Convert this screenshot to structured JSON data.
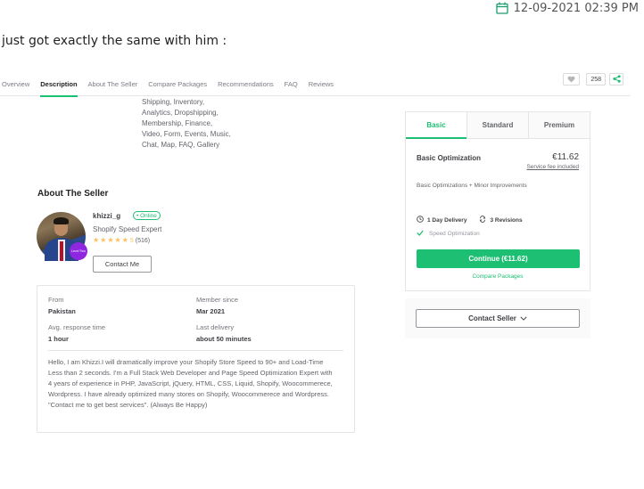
{
  "header": {
    "timestamp": "12-09-2021 02:39 PM",
    "timestamp_icon": "calendar-icon",
    "post_text": "just got exactly the same with him :"
  },
  "nav": {
    "tabs": [
      {
        "label": "Overview",
        "active": false
      },
      {
        "label": "Description",
        "active": true
      },
      {
        "label": "About The Seller",
        "active": false
      },
      {
        "label": "Compare Packages",
        "active": false
      },
      {
        "label": "Recommendations",
        "active": false
      },
      {
        "label": "FAQ",
        "active": false
      },
      {
        "label": "Reviews",
        "active": false
      }
    ],
    "favorite_count": "258",
    "icons": [
      "heart-icon",
      "share-icon"
    ]
  },
  "description": {
    "lines": [
      "Shipping, Inventory,",
      "Analytics, Dropshipping,",
      "Membership, Finance,",
      "Video, Form, Events, Music,",
      "Chat, Map, FAQ, Gallery"
    ]
  },
  "seller": {
    "section_title": "About The Seller",
    "username": "khizzi_g",
    "status": "• Online",
    "title": "Shopify Speed Expert",
    "rating": 5,
    "rating_label": "5",
    "review_count": "(516)",
    "level_badge": "Level Two",
    "contact_label": "Contact Me",
    "stats": {
      "from_label": "From",
      "from_value": "Pakistan",
      "member_label": "Member since",
      "member_value": "Mar 2021",
      "response_label": "Avg. response time",
      "response_value": "1 hour",
      "delivery_label": "Last delivery",
      "delivery_value": "about 50 minutes"
    },
    "bio": "Hello, I am Khizzi.I will dramatically improve your Shopify Store Speed to 90+ and Load-Time Less than 2 seconds. I'm a Full Stack Web Developer and Page Speed Optimization Expert with 4 years of experience in PHP, JavaScript, jQuery, HTML, CSS, Liquid, Shopify, Woocommerece, Wordpress. I have already optimized many stores on Shopify, Woocommerece and Wordpress. \"Contact me to get best services\". (Always Be Happy)"
  },
  "package": {
    "tabs": [
      {
        "label": "Basic",
        "active": true
      },
      {
        "label": "Standard",
        "active": false
      },
      {
        "label": "Premium",
        "active": false
      }
    ],
    "name": "Basic Optimization",
    "price": "€11.62",
    "fee_note": "Service fee included",
    "description": "Basic Optimizations + Minor Improvements",
    "delivery": "1 Day Delivery",
    "revisions": "3 Revisions",
    "features": [
      "Speed Optimization"
    ],
    "continue_label": "Continue (€11.62)",
    "compare_label": "Compare Packages"
  },
  "contact": {
    "label": "Contact Seller"
  },
  "colors": {
    "accent": "#1dbf73",
    "star": "#ffbe5b",
    "level_badge": "#8f27e0"
  }
}
